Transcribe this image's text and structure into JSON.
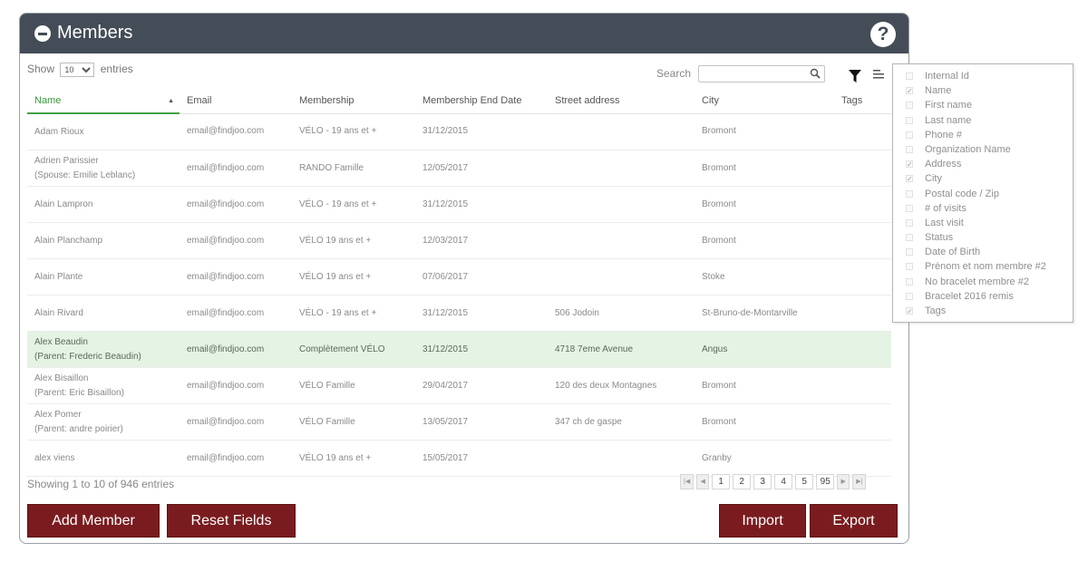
{
  "header": {
    "title": "Members",
    "help_glyph": "?"
  },
  "controls": {
    "show_label": "Show",
    "entries_value": "10",
    "entries_label": "entries",
    "search_label": "Search",
    "search_value": ""
  },
  "table": {
    "columns": [
      "Name",
      "Email",
      "Membership",
      "Membership End Date",
      "Street address",
      "City",
      "Tags"
    ],
    "sorted_column": "Name",
    "rows": [
      {
        "name": "Adam Rioux",
        "name2": "",
        "email": "email@findjoo.com",
        "membership": "VÉLO - 19 ans et +",
        "end_date": "31/12/2015",
        "street": "",
        "city": "Bromont",
        "tags": "",
        "highlight": false
      },
      {
        "name": "Adrien Parissier",
        "name2": "(Spouse: Emilie Leblanc)",
        "email": "email@findjoo.com",
        "membership": "RANDO Famille",
        "end_date": "12/05/2017",
        "street": "",
        "city": "Bromont",
        "tags": "",
        "highlight": false
      },
      {
        "name": "Alain Lampron",
        "name2": "",
        "email": "email@findjoo.com",
        "membership": "VÉLO - 19 ans et +",
        "end_date": "31/12/2015",
        "street": "",
        "city": "Bromont",
        "tags": "",
        "highlight": false
      },
      {
        "name": "Alain Planchamp",
        "name2": "",
        "email": "email@findjoo.com",
        "membership": "VÉLO 19 ans et +",
        "end_date": "12/03/2017",
        "street": "",
        "city": "Bromont",
        "tags": "",
        "highlight": false
      },
      {
        "name": "Alain Plante",
        "name2": "",
        "email": "email@findjoo.com",
        "membership": "VÉLO 19 ans et +",
        "end_date": "07/06/2017",
        "street": "",
        "city": "Stoke",
        "tags": "",
        "highlight": false
      },
      {
        "name": "Alain Rivard",
        "name2": "",
        "email": "email@findjoo.com",
        "membership": "VÉLO - 19 ans et +",
        "end_date": "31/12/2015",
        "street": "506 Jodoin",
        "city": "St-Bruno-de-Montarville",
        "tags": "",
        "highlight": false
      },
      {
        "name": "Alex Beaudin",
        "name2": "(Parent: Frederic Beaudin)",
        "email": "email@findjoo.com",
        "membership": "Complètement VÉLO",
        "end_date": "31/12/2015",
        "street": "4718 7eme Avenue",
        "city": "Angus",
        "tags": "",
        "highlight": true
      },
      {
        "name": "Alex Bisaillon",
        "name2": "(Parent: Eric Bisaillon)",
        "email": "email@findjoo.com",
        "membership": "VÉLO Famille",
        "end_date": "29/04/2017",
        "street": "120 des deux Montagnes",
        "city": "Bromont",
        "tags": "",
        "highlight": false
      },
      {
        "name": "Alex Pomer",
        "name2": "(Parent: andre poirier)",
        "email": "email@findjoo.com",
        "membership": "VÉLO Famille",
        "end_date": "13/05/2017",
        "street": "347 ch de gaspe",
        "city": "Bromont",
        "tags": "",
        "highlight": false
      },
      {
        "name": "alex viens",
        "name2": "",
        "email": "email@findjoo.com",
        "membership": "VÉLO 19 ans et +",
        "end_date": "15/05/2017",
        "street": "",
        "city": "Granby",
        "tags": "",
        "highlight": false
      }
    ]
  },
  "footer": {
    "info": "Showing 1 to 10 of 946 entries",
    "pages": [
      "1",
      "2",
      "3",
      "4",
      "5",
      "95"
    ],
    "nav_glyphs": {
      "first": "|◀",
      "prev": "◀",
      "next": "▶",
      "last": "▶|"
    }
  },
  "buttons": {
    "add_member": "Add Member",
    "reset_fields": "Reset Fields",
    "import": "Import",
    "export": "Export"
  },
  "column_menu": [
    {
      "label": "Internal Id",
      "checked": false
    },
    {
      "label": "Name",
      "checked": true
    },
    {
      "label": "First name",
      "checked": false
    },
    {
      "label": "Last name",
      "checked": false
    },
    {
      "label": "Phone #",
      "checked": false
    },
    {
      "label": "Organization Name",
      "checked": false
    },
    {
      "label": "Address",
      "checked": true
    },
    {
      "label": "City",
      "checked": true
    },
    {
      "label": "Postal code / Zip",
      "checked": false
    },
    {
      "label": "# of visits",
      "checked": false
    },
    {
      "label": "Last visit",
      "checked": false
    },
    {
      "label": "Status",
      "checked": false
    },
    {
      "label": "Date of Birth",
      "checked": false
    },
    {
      "label": "Prénom et nom membre #2",
      "checked": false
    },
    {
      "label": "No bracelet membre #2",
      "checked": false
    },
    {
      "label": "Bracelet 2016 remis",
      "checked": false
    },
    {
      "label": "Tags",
      "checked": true
    }
  ],
  "colors": {
    "header_bg": "#444c57",
    "button_bg": "#7a1c1f",
    "highlight_row": "#e4f3e4",
    "sort_accent": "#43a047"
  }
}
